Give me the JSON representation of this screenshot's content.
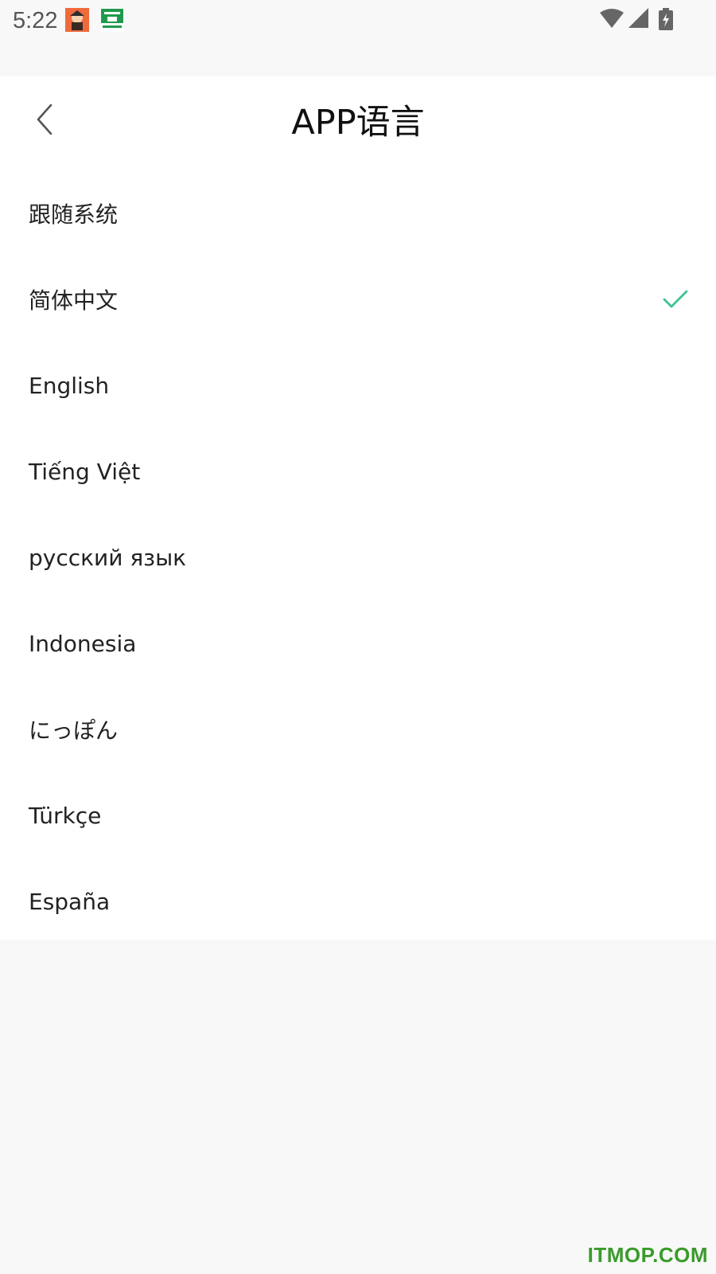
{
  "status_bar": {
    "time": "5:22",
    "icons": [
      "app-notification-icon",
      "app-notification-icon",
      "wifi-icon",
      "signal-icon",
      "battery-charging-icon"
    ]
  },
  "toolbar": {
    "back_icon": "chevron-left-icon",
    "title": "APP语言"
  },
  "languages": {
    "selected_index": 1,
    "accent_color": "#3ec28f",
    "items": [
      {
        "label": "跟随系统"
      },
      {
        "label": "简体中文"
      },
      {
        "label": "English"
      },
      {
        "label": "Tiếng Việt"
      },
      {
        "label": "русский язык"
      },
      {
        "label": "Indonesia"
      },
      {
        "label": "にっぽん"
      },
      {
        "label": "Türkçe"
      },
      {
        "label": "España"
      }
    ]
  },
  "watermark": "ITMOP.COM"
}
